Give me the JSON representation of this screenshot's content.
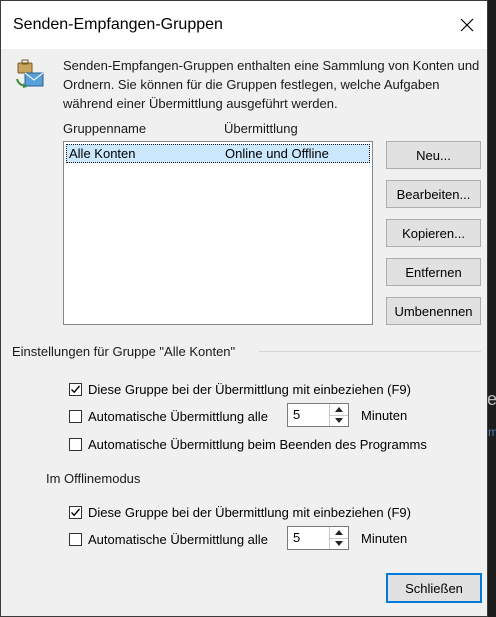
{
  "dialog": {
    "title": "Senden-Empfangen-Gruppen",
    "close_icon": "close-icon",
    "description": "Senden-Empfangen-Gruppen enthalten eine Sammlung von Konten und Ordnern. Sie können für die Gruppen festlegen, welche Aufgaben während einer Übermittlung ausgeführt werden."
  },
  "groups": {
    "col_name": "Gruppenname",
    "col_transfer": "Übermittlung",
    "rows": [
      {
        "name": "Alle Konten",
        "transfer": "Online und Offline",
        "selected": true
      }
    ]
  },
  "buttons": {
    "new": "Neu...",
    "edit": "Bearbeiten...",
    "copy": "Kopieren...",
    "remove": "Entfernen",
    "rename": "Umbenennen",
    "close": "Schließen"
  },
  "settings": {
    "header": "Einstellungen für Gruppe \"Alle Konten\"",
    "include_label": "Diese Gruppe bei der Übermittlung mit einbeziehen (F9)",
    "include_checked": true,
    "auto_label": "Automatische Übermittlung alle",
    "auto_checked": false,
    "auto_value": "5",
    "auto_unit": "Minuten",
    "on_exit_label": "Automatische Übermittlung beim Beenden des Programms",
    "on_exit_checked": false
  },
  "offline": {
    "header": "Im Offlinemodus",
    "include_label": "Diese Gruppe bei der Übermittlung mit einbeziehen (F9)",
    "include_checked": true,
    "auto_label": "Automatische Übermittlung alle",
    "auto_checked": false,
    "auto_value": "5",
    "auto_unit": "Minuten"
  },
  "background": {
    "letter_1": "e",
    "letter_2": "m"
  }
}
